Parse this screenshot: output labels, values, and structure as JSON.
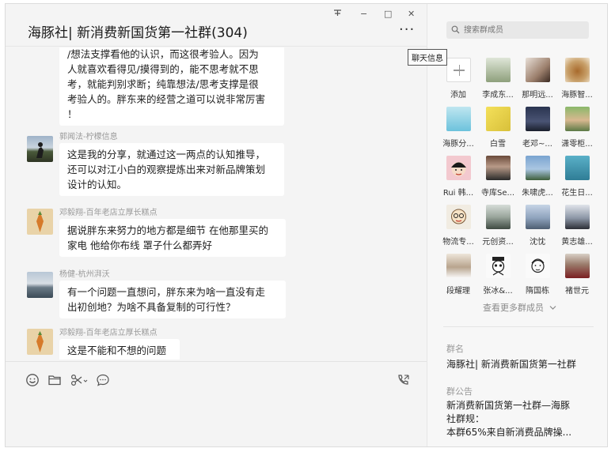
{
  "window_controls": {
    "pin": "푸",
    "minimize": "−",
    "maximize": "□",
    "close": "✕"
  },
  "chat": {
    "title": "海豚社| 新消费新国货第一社群(304)",
    "more_label": "···",
    "messages": [
      {
        "sender": "",
        "lines": [
          "/想法支撑看他的认识，而这很考验人。因为",
          "人就喜欢看得见/摸得到的，能不思考就不思",
          "考，就能判别求断；纯靠想法/思考支撑是很",
          "考验人的。胖东来的经营之道可以说非常厉害",
          "！"
        ]
      },
      {
        "sender": "郭闻法-柠檬信息",
        "lines": [
          "这是我的分享，就通过这一两点的认知推导，",
          "还可以对江小白的观察提炼出来对新品牌策划",
          "设计的认知。"
        ]
      },
      {
        "sender": "邓毅翔-百年老店立厚长糕点",
        "lines": [
          "据说胖东来努力的地方都是细节 在他那里买的",
          "家电 他给你布线 罩子什么都弄好"
        ]
      },
      {
        "sender": "杨健-杭州湃沃",
        "lines": [
          "有一个问题一直想问，胖东来为啥一直没有走",
          "出初创地？为啥不具备复制的可行性？"
        ]
      },
      {
        "sender": "邓毅翔-百年老店立厚长糕点",
        "lines": [
          "这是不能和不想的问题"
        ]
      }
    ]
  },
  "tools": {
    "emoji": "emoji-icon",
    "folder": "folder-icon",
    "scissors": "scissors-icon",
    "chat_bubble": "chat-bubble-icon",
    "video_call": "video-call-icon"
  },
  "panel": {
    "search_placeholder": "搜索群成员",
    "tooltip": "聊天信息",
    "members": [
      "添加",
      "李成东...",
      "那明远...",
      "海豚智...",
      "海豚分...",
      "白雪",
      "老邓~...",
      "潇零柜...",
      "Rui 韩...",
      "寺库Se...",
      "朱啸虎...",
      "花生日...",
      "物流专...",
      "元创资...",
      "沈忱",
      "黄志雄...",
      "段耀理",
      "张冰&...",
      "隋国栋",
      "褚世元"
    ],
    "view_more": "查看更多群成员",
    "group_name_label": "群名",
    "group_name": "海豚社| 新消费新国货第一社群",
    "announcement_label": "群公告",
    "announcement_lines": [
      "新消费新国货第一社群—海豚",
      "社群规：",
      "本群65%来自新消费品牌操..."
    ]
  },
  "colors": {
    "window_bg": "#f4f4f4",
    "bubble_bg": "#ffffff",
    "panel_bg": "#f7f7f7"
  }
}
